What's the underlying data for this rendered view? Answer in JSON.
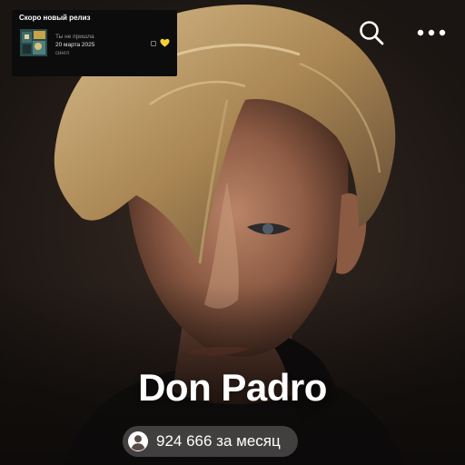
{
  "release": {
    "heading": "Скоро новый релиз",
    "title": "Ты не пришла",
    "date": "20 марта 2025",
    "type": "сингл"
  },
  "artist": {
    "name": "Don Padro",
    "listeners": "924 666 за месяц"
  },
  "icons": {
    "search": "search-icon",
    "more": "more-horizontal-icon",
    "listeners": "person-circle-icon",
    "heart": "heart-icon",
    "explicit": "explicit-badge-icon"
  },
  "colors": {
    "accent": "#f5d038",
    "card_bg": "#0c0c0c",
    "pill_bg": "rgba(255,255,255,0.22)"
  }
}
